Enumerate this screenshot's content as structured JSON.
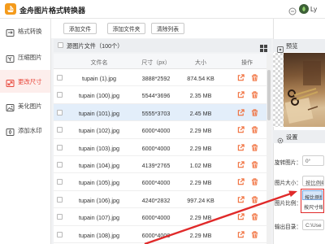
{
  "app": {
    "title": "金舟图片格式转换器",
    "user": "Ly"
  },
  "sidebar": {
    "items": [
      {
        "label": "格式转换",
        "icon": "format-convert-icon"
      },
      {
        "label": "压缩图片",
        "icon": "compress-icon"
      },
      {
        "label": "更改尺寸",
        "icon": "resize-icon",
        "active": true
      },
      {
        "label": "美化图片",
        "icon": "beautify-icon"
      },
      {
        "label": "添加水印",
        "icon": "watermark-icon"
      }
    ]
  },
  "toolbar": {
    "add_file": "添加文件",
    "add_folder": "添加文件夹",
    "clear_list": "清除列表"
  },
  "file_panel": {
    "title": "源图片文件（100个）",
    "columns": [
      "文件名",
      "尺寸（px）",
      "大小",
      "操作"
    ],
    "rows": [
      {
        "name": "tupain (1).jpg",
        "dimensions": "3888*2592",
        "size": "874.54 KB"
      },
      {
        "name": "tupain (100).jpg",
        "dimensions": "5544*3696",
        "size": "2.35 MB"
      },
      {
        "name": "tupain (101).jpg",
        "dimensions": "5555*3703",
        "size": "2.45 MB",
        "selected": true
      },
      {
        "name": "tupain (102).jpg",
        "dimensions": "6000*4000",
        "size": "2.29 MB"
      },
      {
        "name": "tupain (103).jpg",
        "dimensions": "6000*4000",
        "size": "2.29 MB"
      },
      {
        "name": "tupain (104).jpg",
        "dimensions": "4139*2765",
        "size": "1.02 MB"
      },
      {
        "name": "tupain (105).jpg",
        "dimensions": "6000*4000",
        "size": "2.29 MB"
      },
      {
        "name": "tupain (106).jpg",
        "dimensions": "4240*2832",
        "size": "997.24 KB"
      },
      {
        "name": "tupain (107).jpg",
        "dimensions": "6000*4000",
        "size": "2.29 MB"
      },
      {
        "name": "tupain (108).jpg",
        "dimensions": "6000*4000",
        "size": "2.29 MB"
      }
    ]
  },
  "preview": {
    "title": "预览"
  },
  "settings": {
    "title": "设置",
    "rotate_label": "旋转图片：",
    "rotate_value": "0°",
    "size_label": "图片大小：",
    "size_value": "按比例缩放",
    "size_options": [
      "按比例缩放",
      "按尺寸缩放"
    ],
    "ratio_label": "图片比例：",
    "output_label": "输出目录：",
    "output_value": "C:\\Use"
  },
  "colors": {
    "accent": "#e8463a",
    "action_icon": "#f06a35",
    "selected_row": "#e3eefa",
    "annotation": "#e02a2a"
  }
}
